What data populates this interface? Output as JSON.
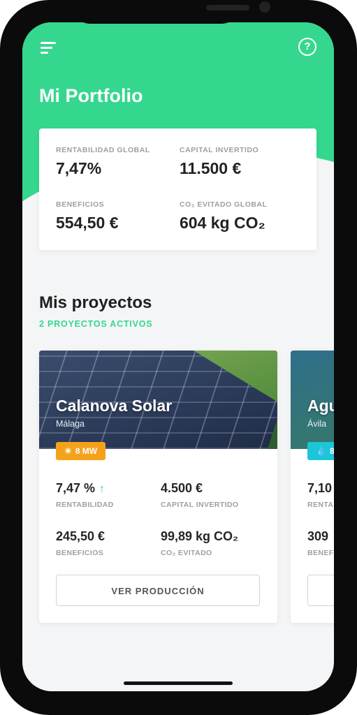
{
  "header": {
    "title": "Mi Portfolio"
  },
  "summary": {
    "rentabilidad_label": "RENTABILIDAD GLOBAL",
    "rentabilidad_value": "7,47%",
    "capital_label": "CAPITAL INVERTIDO",
    "capital_value": "11.500 €",
    "beneficios_label": "BENEFICIOS",
    "beneficios_value": "554,50 €",
    "co2_label": "CO₂ EVITADO GLOBAL",
    "co2_value": "604 kg CO₂"
  },
  "projects": {
    "title": "Mis proyectos",
    "subtitle": "2 PROYECTOS ACTIVOS",
    "items": [
      {
        "name": "Calanova Solar",
        "location": "Málaga",
        "badge": "8 MW",
        "badge_icon": "sun-icon",
        "badge_color": "#f5a21b",
        "rentabilidad": "7,47 %",
        "rentabilidad_label": "RENTABILIDAD",
        "capital": "4.500 €",
        "capital_label": "CAPITAL INVERTIDO",
        "beneficios": "245,50 €",
        "beneficios_label": "BENEFICIOS",
        "co2": "99,89 kg CO₂",
        "co2_label": "CO₂ EVITADO",
        "button": "VER PRODUCCIÓN"
      },
      {
        "name": "Agu",
        "location": "Ávila",
        "badge": "8",
        "badge_icon": "drop-icon",
        "badge_color": "#1cc6d8",
        "rentabilidad": "7,10",
        "rentabilidad_label": "RENTA",
        "beneficios": "309",
        "beneficios_label": "BENEF"
      }
    ]
  },
  "colors": {
    "brand": "#35d78f",
    "background": "#f4f5f6"
  }
}
